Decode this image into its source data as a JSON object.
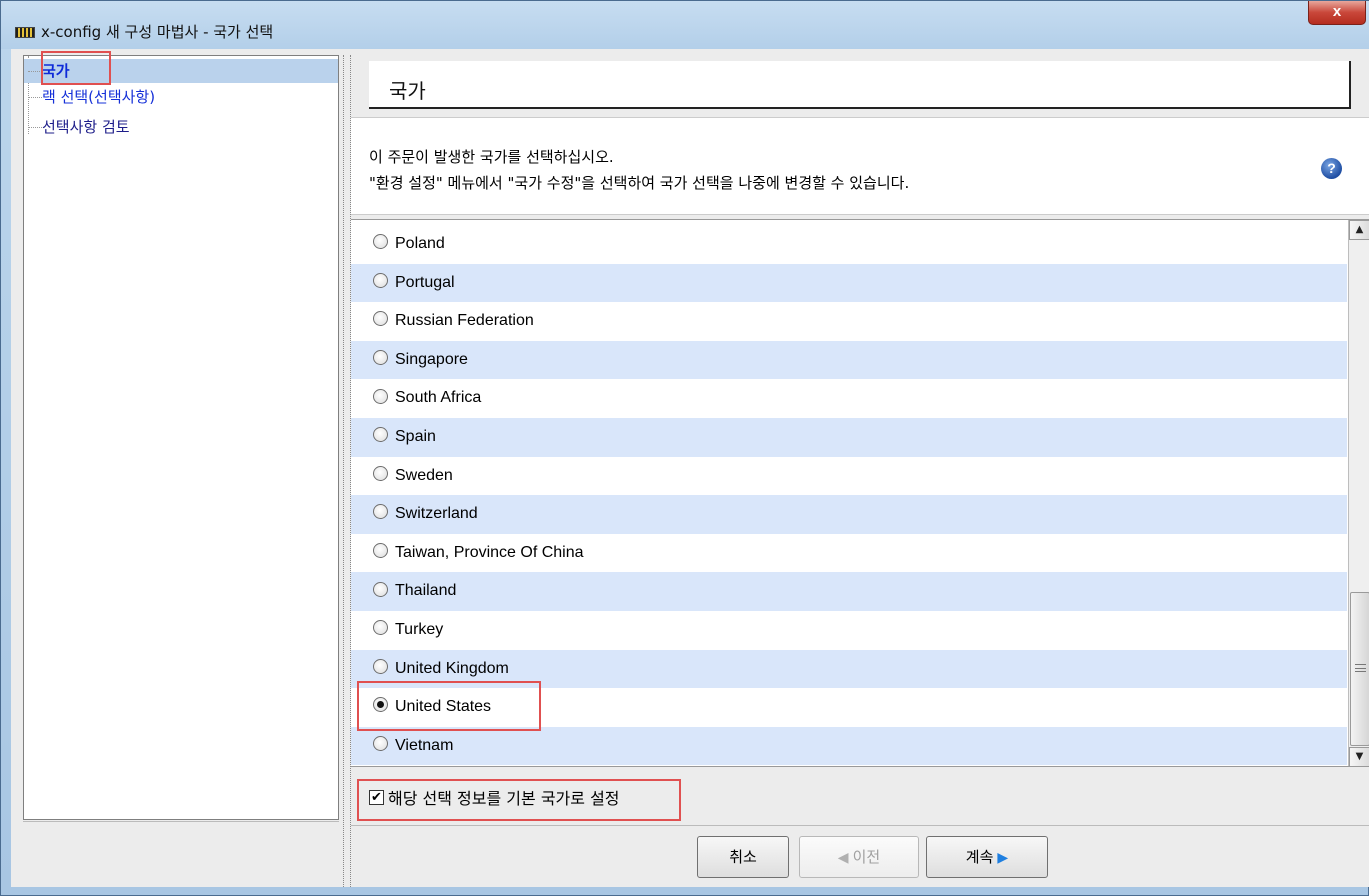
{
  "window": {
    "title": "x-config 새 구성 마법사 - 국가 선택",
    "close_label": "x"
  },
  "sidebar": {
    "items": [
      {
        "label": "국가",
        "selected": true
      },
      {
        "label": "랙 선택(선택사항)",
        "selected": false
      },
      {
        "label": "선택사항 검토",
        "selected": false
      }
    ]
  },
  "header": {
    "title": "국가"
  },
  "info": {
    "line1": "이 주문이 발생한 국가를 선택하십시오.",
    "line2": "\"환경 설정\" 메뉴에서 \"국가 수정\"을 선택하여 국가 선택을 나중에 변경할 수 있습니다.",
    "help_icon": "help-icon"
  },
  "countries": [
    {
      "label": "Poland",
      "checked": false
    },
    {
      "label": "Portugal",
      "checked": false
    },
    {
      "label": "Russian Federation",
      "checked": false
    },
    {
      "label": "Singapore",
      "checked": false
    },
    {
      "label": "South Africa",
      "checked": false
    },
    {
      "label": "Spain",
      "checked": false
    },
    {
      "label": "Sweden",
      "checked": false
    },
    {
      "label": "Switzerland",
      "checked": false
    },
    {
      "label": "Taiwan, Province Of China",
      "checked": false
    },
    {
      "label": "Thailand",
      "checked": false
    },
    {
      "label": "Turkey",
      "checked": false
    },
    {
      "label": "United Kingdom",
      "checked": false
    },
    {
      "label": "United States",
      "checked": true
    },
    {
      "label": "Vietnam",
      "checked": false
    }
  ],
  "default_checkbox": {
    "label": "해당 선택 정보를 기본 국가로 설정",
    "checked": true
  },
  "buttons": {
    "cancel": "취소",
    "previous": "이전",
    "next": "계속"
  },
  "colors": {
    "selection_highlight": "#bad2ec",
    "row_alternate": "#d9e6fa",
    "annotation_box": "#e05050"
  }
}
